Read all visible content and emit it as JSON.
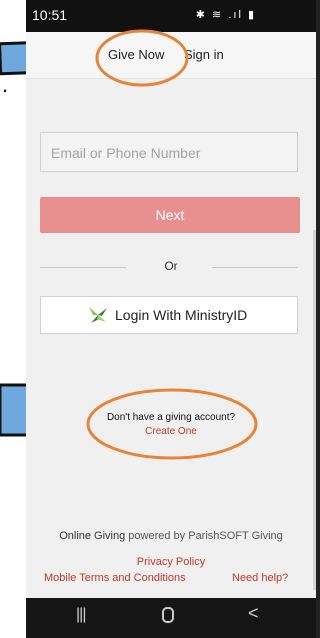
{
  "status": {
    "time": "10:51",
    "icons": "✱ ≋ .ıl ▮"
  },
  "nav": {
    "give_now": "Give Now",
    "sign_in": "Sign in"
  },
  "login": {
    "email_placeholder": "Email or Phone Number",
    "next": "Next",
    "or": "Or",
    "ministry_button": "Login With MinistryID"
  },
  "account": {
    "question": "Don't have a giving account?",
    "create": "Create One"
  },
  "footer": {
    "online_giving": "Online Giving",
    "powered_by": " powered by ParishSOFT Giving",
    "privacy": "Privacy Policy",
    "mobile_terms": "Mobile Terms and Conditions",
    "need_help": "Need help?"
  },
  "system_nav": {
    "recent": "|||",
    "back": "<"
  },
  "page_mark": "."
}
